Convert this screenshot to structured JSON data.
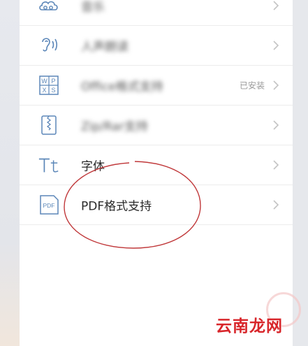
{
  "settings": {
    "items": [
      {
        "label": "音乐",
        "status": "",
        "icon": "cloud-icon",
        "blurred": true
      },
      {
        "label": "人声朗读",
        "status": "",
        "icon": "voice-ear-icon",
        "blurred": true
      },
      {
        "label": "Office格式支持",
        "status": "已安装",
        "icon": "office-icon",
        "blurred": true
      },
      {
        "label": "Zip/Rar支持",
        "status": "",
        "icon": "zip-icon",
        "blurred": true
      },
      {
        "label": "字体",
        "status": "",
        "icon": "font-icon",
        "blurred": false
      },
      {
        "label": "PDF格式支持",
        "status": "",
        "icon": "pdf-icon",
        "blurred": false
      }
    ]
  },
  "office_icon_letters": [
    "W",
    "P",
    "X",
    "S"
  ],
  "pdf_icon_text": "PDF",
  "watermark": "云南龙网",
  "colors": {
    "icon_blue": "#5b86b8",
    "annotation_circle": "#c0383a",
    "watermark": "#d8262b",
    "status_text": "#9a9a9a"
  }
}
